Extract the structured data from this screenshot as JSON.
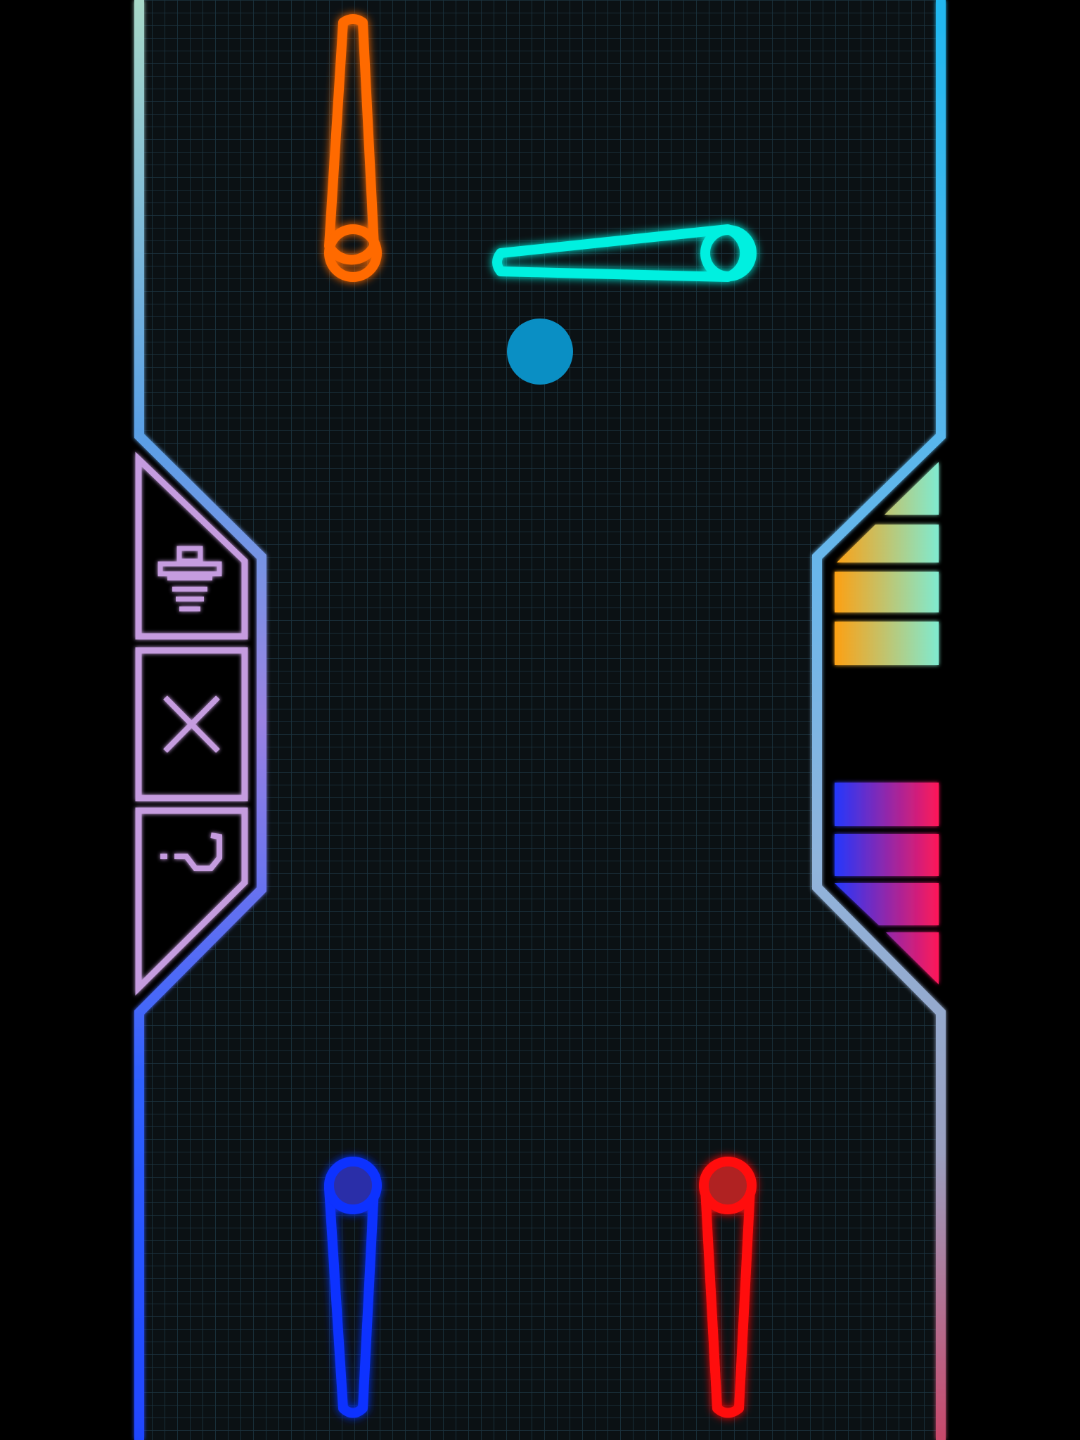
{
  "game": {
    "type": "neon-pinball",
    "background": "#000000",
    "grid_color": "#1f3a44",
    "ball": {
      "color": "#0a8fc4"
    }
  },
  "flippers": [
    {
      "id": "top-left",
      "color": "#ff6a00",
      "orientation": "down"
    },
    {
      "id": "top-right",
      "color": "#00f0e0",
      "orientation": "left"
    },
    {
      "id": "bottom-left",
      "color": "#1030ff",
      "orientation": "up"
    },
    {
      "id": "bottom-right",
      "color": "#ff1010",
      "orientation": "up"
    }
  ],
  "walls": {
    "left_gradient": [
      "#a8d8c8",
      "#4a90e0",
      "#9b7fe0",
      "#1f55ff"
    ],
    "right_gradient": [
      "#2fb8e8",
      "#6fb4e8",
      "#8fb0d8",
      "#c06080"
    ]
  },
  "left_panel": {
    "color": "#c69be0",
    "buttons": [
      {
        "name": "avatar",
        "icon": "robot-icon"
      },
      {
        "name": "close",
        "icon": "close-icon"
      },
      {
        "name": "help",
        "icon": "question-icon"
      }
    ]
  },
  "right_panel": {
    "top_meter": {
      "colors": [
        "#ff9f1a",
        "#7fe8c8"
      ],
      "level": 1.0
    },
    "bottom_meter": {
      "colors": [
        "#2a3cff",
        "#ff1a60"
      ],
      "level": 1.0
    }
  }
}
